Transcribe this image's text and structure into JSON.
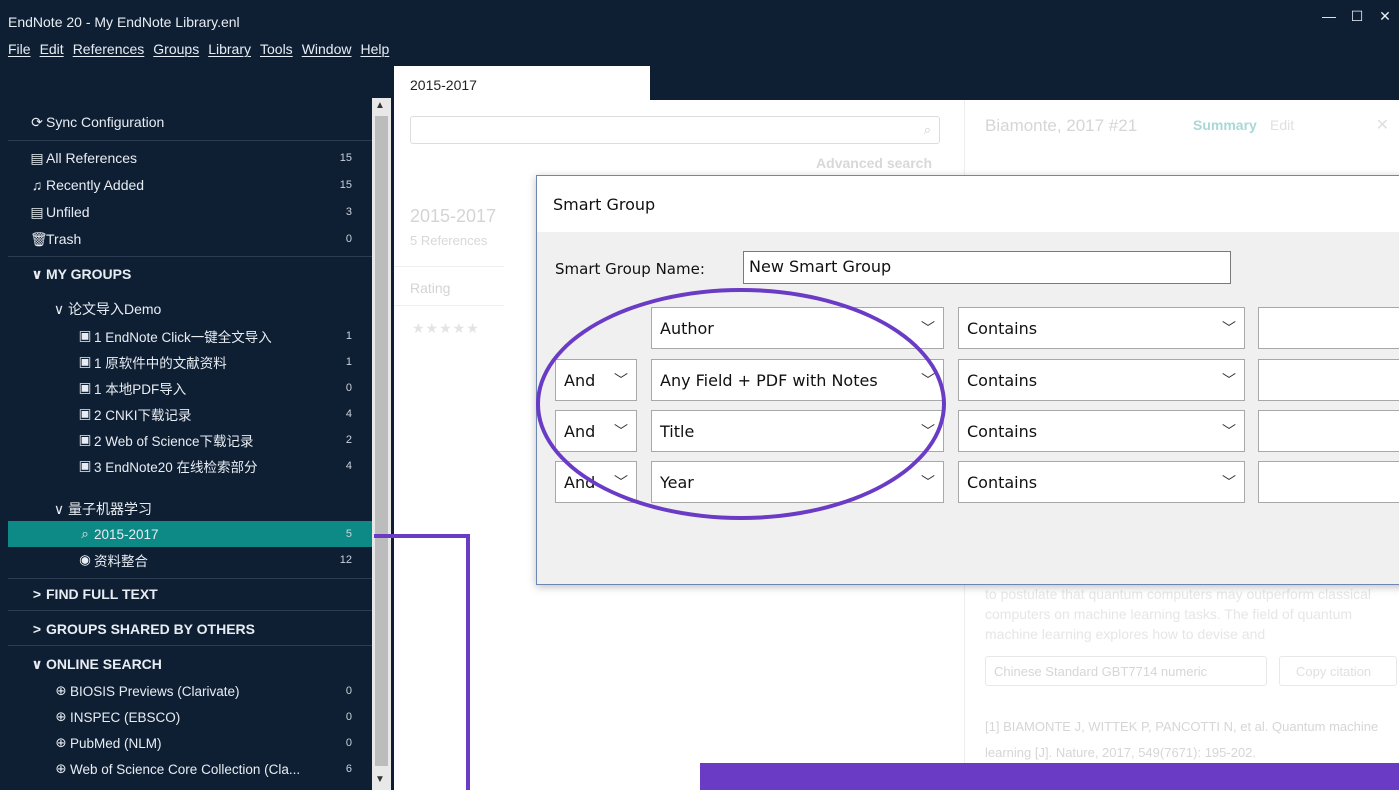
{
  "window": {
    "title": "EndNote 20 - My EndNote Library.enl",
    "controls": {
      "minimize": "—",
      "maximize": "☐",
      "close": "✕"
    }
  },
  "menu": [
    "File",
    "Edit",
    "References",
    "Groups",
    "Library",
    "Tools",
    "Window",
    "Help"
  ],
  "sidebar": {
    "sync": "Sync Configuration",
    "library": [
      {
        "label": "All References",
        "count": "15",
        "icon": "references-icon"
      },
      {
        "label": "Recently Added",
        "count": "15",
        "icon": "bell-icon"
      },
      {
        "label": "Unfiled",
        "count": "3",
        "icon": "unfiled-icon"
      },
      {
        "label": "Trash",
        "count": "0",
        "icon": "trash-icon"
      }
    ],
    "my_groups": "MY GROUPS",
    "group_set_1": "论文导入Demo",
    "groups_1": [
      {
        "label": "1 EndNote Click一键全文导入",
        "count": "1"
      },
      {
        "label": "1 原软件中的文献资料",
        "count": "1"
      },
      {
        "label": "1 本地PDF导入",
        "count": "0"
      },
      {
        "label": "2 CNKI下载记录",
        "count": "4"
      },
      {
        "label": "2 Web of Science下载记录",
        "count": "2"
      },
      {
        "label": "3 EndNote20 在线检索部分",
        "count": "4"
      }
    ],
    "group_set_2": "量子机器学习",
    "groups_2": [
      {
        "label": "2015-2017",
        "count": "5"
      },
      {
        "label": "资料整合",
        "count": "12"
      }
    ],
    "find_full_text": "FIND FULL TEXT",
    "shared": "GROUPS SHARED BY OTHERS",
    "online_search": "ONLINE SEARCH",
    "online": [
      {
        "label": "BIOSIS Previews (Clarivate)",
        "count": "0"
      },
      {
        "label": "INSPEC (EBSCO)",
        "count": "0"
      },
      {
        "label": "PubMed (NLM)",
        "count": "0"
      },
      {
        "label": "Web of Science Core Collection (Cla...",
        "count": "6"
      }
    ]
  },
  "tab": {
    "label": "2015-2017"
  },
  "list_panel": {
    "advanced_search": "Advanced search",
    "group_title": "2015-2017",
    "ref_count": "5 References",
    "col_rating": "Rating",
    "stars": "★★★★★"
  },
  "reference": {
    "title": "Biamonte, 2017 #21",
    "summary": "Summary",
    "edit": "Edit",
    "close": "✕",
    "abstract": "to postulate that quantum computers may outperform classical computers on machine learning tasks. The field of quantum machine learning explores how to devise and",
    "style": "Chinese Standard GBT7714 numeric",
    "copy_citation": "Copy citation",
    "citation": "[1]      BIAMONTE J, WITTEK P, PANCOTTI N, et al. Quantum machine learning [J]. Nature, 2017, 549(7671): 195-202."
  },
  "dialog": {
    "title": "Smart Group",
    "name_label": "Smart Group Name:",
    "name_value": "New Smart Group",
    "rows": [
      {
        "connector": "",
        "field": "Author",
        "op": "Contains"
      },
      {
        "connector": "And",
        "field": "Any Field + PDF with Notes",
        "op": "Contains"
      },
      {
        "connector": "And",
        "field": "Title",
        "op": "Contains"
      },
      {
        "connector": "And",
        "field": "Year",
        "op": "Contains"
      }
    ]
  },
  "colors": {
    "sidebar_bg": "#0f1f33",
    "selected": "#0d8a86",
    "annotation": "#6a3bc4"
  }
}
